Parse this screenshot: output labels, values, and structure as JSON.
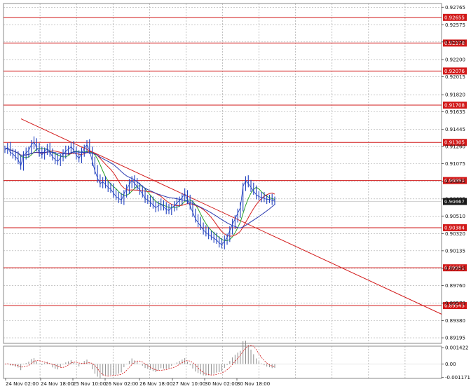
{
  "chart_data": {
    "type": "line",
    "instrument_note": "",
    "price_axis": {
      "ylim": [
        0.89135,
        0.92805
      ],
      "ticks": [
        "0.92765",
        "0.92575",
        "0.92390",
        "0.92200",
        "0.92015",
        "0.91820",
        "0.91635",
        "0.91445",
        "0.91260",
        "0.91075",
        "0.90885",
        "0.90695",
        "0.90510",
        "0.90320",
        "0.90135",
        "0.89945",
        "0.89760",
        "0.89570",
        "0.89380",
        "0.89195"
      ]
    },
    "time_axis": {
      "labels": [
        "24 Nov 02:00",
        "24 Nov 18:00",
        "25 Nov 10:00",
        "26 Nov 02:00",
        "26 Nov 18:00",
        "27 Nov 10:00",
        "30 Nov 02:00",
        "30 Nov 18:00"
      ]
    },
    "horizontal_levels": [
      "0.92655",
      "0.92378",
      "0.92076",
      "0.91708",
      "0.91305",
      "0.90893",
      "0.90384",
      "0.89951",
      "0.89543"
    ],
    "current_price": "0.90667",
    "trendline": {
      "from": [
        0,
        0.9156
      ],
      "to": [
        125,
        0.8945
      ]
    },
    "series": [
      {
        "kind": "price",
        "color": "#1f3fbf",
        "values": [
          0.9123,
          0.9125,
          0.912,
          0.9118,
          0.9115,
          0.9112,
          0.9105,
          0.9116,
          0.9119,
          0.9122,
          0.9128,
          0.9131,
          0.9125,
          0.912,
          0.9117,
          0.9121,
          0.9124,
          0.912,
          0.9115,
          0.9112,
          0.911,
          0.9114,
          0.9118,
          0.9121,
          0.9123,
          0.9126,
          0.9122,
          0.9117,
          0.9113,
          0.9119,
          0.9124,
          0.9128,
          0.9122,
          0.911,
          0.91,
          0.9092,
          0.9086,
          0.9088,
          0.9085,
          0.9082,
          0.908,
          0.9076,
          0.9072,
          0.907,
          0.9068,
          0.9075,
          0.908,
          0.9085,
          0.909,
          0.9086,
          0.9083,
          0.9079,
          0.9075,
          0.907,
          0.9068,
          0.9066,
          0.9063,
          0.906,
          0.9062,
          0.9064,
          0.9061,
          0.9058,
          0.9057,
          0.906,
          0.9062,
          0.9065,
          0.9068,
          0.9071,
          0.9075,
          0.9069,
          0.9062,
          0.9055,
          0.9048,
          0.9044,
          0.904,
          0.9036,
          0.9033,
          0.9031,
          0.9029,
          0.9027,
          0.9025,
          0.9022,
          0.902,
          0.9024,
          0.9028,
          0.9035,
          0.9042,
          0.9048,
          0.9054,
          0.906,
          0.9083,
          0.9089,
          0.9086,
          0.9082,
          0.9078,
          0.9074,
          0.9072,
          0.9071,
          0.907,
          0.9069,
          0.9069,
          0.9068,
          0.9067
        ]
      },
      {
        "kind": "ma-fast",
        "color": "#2aa02a"
      },
      {
        "kind": "ma-medium",
        "color": "#d62020"
      },
      {
        "kind": "ma-slow",
        "color": "#2a3ab0"
      }
    ],
    "oscillator": {
      "ylim": [
        -0.00125,
        0.00155
      ],
      "ticks": [
        "0.001422",
        "0.00",
        "-0.001171"
      ]
    },
    "grid": true
  }
}
